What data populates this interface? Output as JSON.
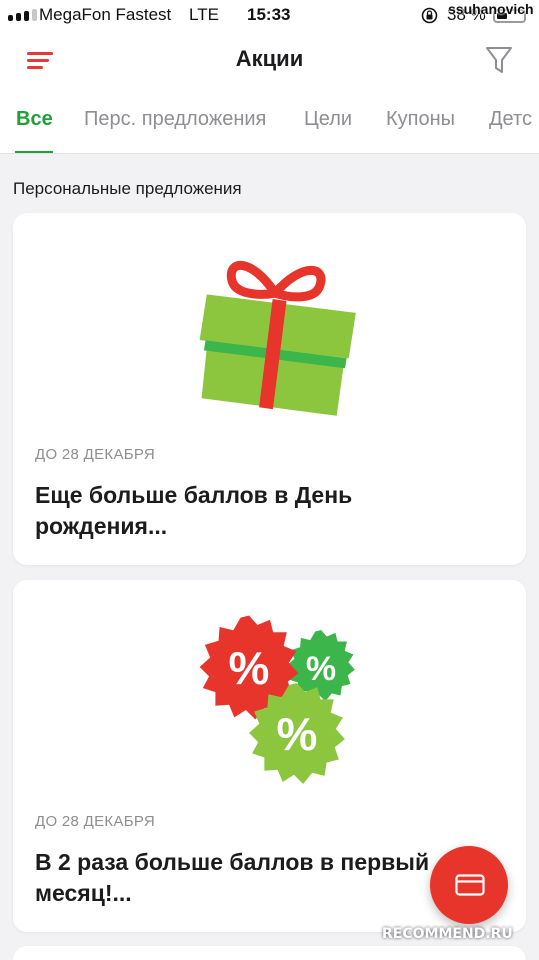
{
  "status_bar": {
    "carrier": "MegaFon Fastest",
    "network": "LTE",
    "time": "15:33",
    "battery_text": "38 %",
    "overlay_user": "ssuhanovich"
  },
  "header": {
    "title": "Акции",
    "menu_icon": "hamburger-menu-icon",
    "filter_icon": "filter-funnel-icon",
    "accent_color": "#e53935"
  },
  "tabs": [
    {
      "label": "Все",
      "active": true
    },
    {
      "label": "Перс. предложения",
      "active": false
    },
    {
      "label": "Цели",
      "active": false
    },
    {
      "label": "Купоны",
      "active": false
    },
    {
      "label": "Детс",
      "active": false
    }
  ],
  "tab_active_color": "#21a038",
  "section": {
    "title": "Персональные предложения"
  },
  "offers": [
    {
      "image": "gift-box-icon",
      "date": "ДО 28 ДЕКАБРЯ",
      "title": "Еще больше баллов в День рождения..."
    },
    {
      "image": "percent-badges-icon",
      "date": "ДО 28 ДЕКАБРЯ",
      "title": "В 2 раза больше баллов в первый месяц!..."
    }
  ],
  "fab": {
    "icon": "card-icon",
    "color": "#e8352b"
  },
  "watermark": "RECOMMEND.RU"
}
